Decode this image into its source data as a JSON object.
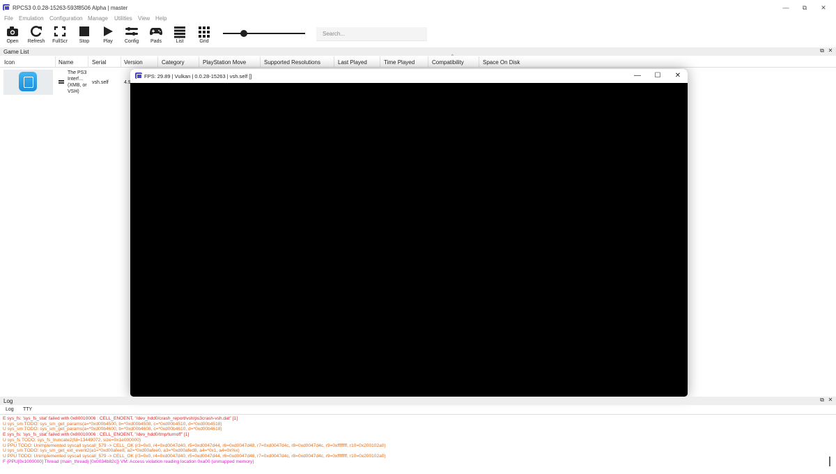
{
  "window": {
    "title": "RPCS3 0.0.28-15263-593f8506 Alpha | master",
    "minimize": "—",
    "maximize": "⧉",
    "close": "✕"
  },
  "menu": [
    "File",
    "Emulation",
    "Configuration",
    "Manage",
    "Utilities",
    "View",
    "Help"
  ],
  "toolbar": {
    "open": "Open",
    "refresh": "Refresh",
    "fullscreen": "FullScr",
    "stop": "Stop",
    "play": "Play",
    "config": "Config",
    "pads": "Pads",
    "list": "List",
    "grid": "Grid",
    "search_placeholder": "Search...",
    "zoom_level": 0.25
  },
  "game_list": {
    "dock_title": "Game List",
    "float_icon": "⧉",
    "close_icon": "✕",
    "columns": [
      "Icon",
      "Name",
      "Serial",
      "Version",
      "Category",
      "PlayStation Move",
      "Supported Resolutions",
      "Last Played",
      "Time Played",
      "Compatibility",
      "Space On Disk"
    ],
    "sort_indicator": "^",
    "rows": [
      {
        "name": "The PS3 Interf… (XMB, or VSH)",
        "serial": "vsh.self",
        "version": "4.9"
      }
    ]
  },
  "emulator_window": {
    "title": "FPS: 29.89 | Vulkan | 0.0.28-15263 | vsh.self []",
    "minimize": "—",
    "maximize": "☐",
    "close": "✕"
  },
  "log": {
    "dock_title": "Log",
    "tabs": [
      "Log",
      "TTY"
    ],
    "colors": {
      "error": "#d03030",
      "warning": "#e07020",
      "fatal": "#e020d0"
    },
    "lines": [
      {
        "text": "E sys_fs: 'sys_fs_stat' failed with 0x80010006 : CELL_ENOENT, \"/dev_hdd0/crash_report/vsh/ps3crash-vsh.dat\" [1]",
        "level": "error"
      },
      {
        "text": "U sys_sm TODO: sys_sm_get_params(a=*0xd00b4500, b=*0xd00b4508, c=*0xd00b4510, d=*0xd00b4518)",
        "level": "warning"
      },
      {
        "text": "U sys_sm TODO: sys_sm_get_params(a=*0xd00b4600, b=*0xd00b4608, c=*0xd00b4610, d=*0xd00b4618)",
        "level": "warning"
      },
      {
        "text": "E sys_fs: 'sys_fs_stat' failed with 0x80010006 : CELL_ENOENT, \"/dev_hdd0/tmp/turnoff\" [1]",
        "level": "error"
      },
      {
        "text": "U sys_fs TODO: sys_fs_truncate2(fd=13449072, size=0x1e000000)",
        "level": "warning"
      },
      {
        "text": "U PPU TODO: Unimplemented syscall syscall_579 -> CELL_OK (r3=0x0, r4=0xd0047d40, r5=0xd0047d44, r6=0xd0047d48, r7=0xd0047d4c, r8=0xd0047d4c, r9=0xffffffff, r10=0x200102a0)",
        "level": "warning"
      },
      {
        "text": "U sys_sm TODO: sys_sm_get_ext_event2(a1=*0xd00afee8, a2=*0xd00afee0, a3=*0xd00afed8, a4=*0x1, a4=0x%x)",
        "level": "warning"
      },
      {
        "text": "U PPU TODO: Unimplemented syscall syscall_579 -> CELL_OK (r3=0x0, r4=0xd0047d40, r5=0xd0047d44, r6=0xd0047d48, r7=0xd0047d4c, r8=0xd0047d4c, r9=0xffffffff, r10=0x200102a0)",
        "level": "warning"
      },
      {
        "text": "F {PPU[0x1000000] Thread (main_thread) [0x0034b82c]} VM: Access violation reading location 0xa00 (unmapped memory)",
        "level": "fatal"
      }
    ]
  }
}
